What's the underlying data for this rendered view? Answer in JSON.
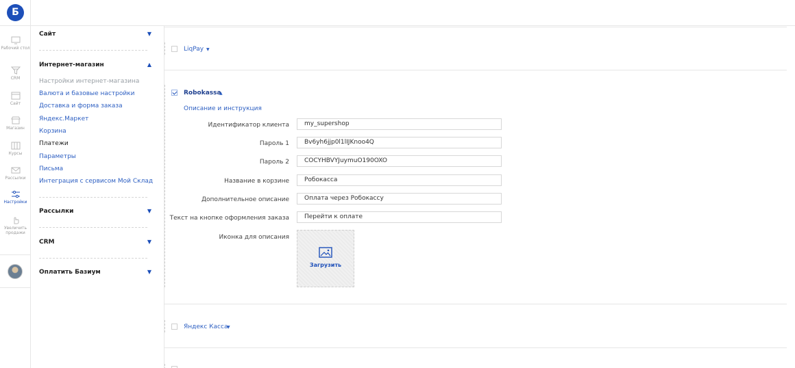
{
  "app": {
    "logo_letter": "Б",
    "accent_color": "#1d4fb9"
  },
  "rail": {
    "items": [
      {
        "label": "Рабочий стол",
        "icon": "desktop-icon"
      },
      {
        "label": "CRM",
        "icon": "funnel-icon"
      },
      {
        "label": "Сайт",
        "icon": "site-icon"
      },
      {
        "label": "Магазин",
        "icon": "store-icon"
      },
      {
        "label": "Курсы",
        "icon": "courses-icon"
      },
      {
        "label": "Рассылки",
        "icon": "mail-icon"
      },
      {
        "label": "Настройки",
        "icon": "sliders-icon"
      },
      {
        "label": "Увеличить продажи",
        "icon": "hand-pointer-icon"
      }
    ]
  },
  "nav": {
    "site": {
      "label": "Сайт"
    },
    "shop": {
      "label": "Интернет-магазин",
      "items": [
        "Настройки интернет-магазина",
        "Валюта и базовые настройки",
        "Доставка и форма заказа",
        "Яндекс.Маркет",
        "Корзина",
        "Платежи",
        "Параметры",
        "Письма",
        "Интеграция с сервисом Мой Склад"
      ]
    },
    "mailings": {
      "label": "Рассылки"
    },
    "crm": {
      "label": "CRM"
    },
    "pay": {
      "label": "Оплатить Базиум"
    }
  },
  "payments": {
    "liqpay": {
      "name": "LiqPay"
    },
    "robokassa": {
      "name": "Robokassa",
      "instructions_link": "Описание и инструкция",
      "fields": [
        {
          "label": "Идентификатор клиента",
          "value": "my_supershop"
        },
        {
          "label": "Пароль 1",
          "value": "Bv6yh6jjp0l1lIJKnoo4Q"
        },
        {
          "label": "Пароль 2",
          "value": "COCYHBVYJuymuO190OXO"
        },
        {
          "label": "Название в корзине",
          "value": "Робокасса"
        },
        {
          "label": "Дополнительное описание",
          "value": "Оплата через Робокассу"
        },
        {
          "label": "Текст на кнопке оформления заказа",
          "value": "Перейти к оплате"
        }
      ],
      "icon_label": "Иконка для описания",
      "upload_label": "Загрузить"
    },
    "yandex": {
      "name": "Яндекс Касса"
    }
  }
}
